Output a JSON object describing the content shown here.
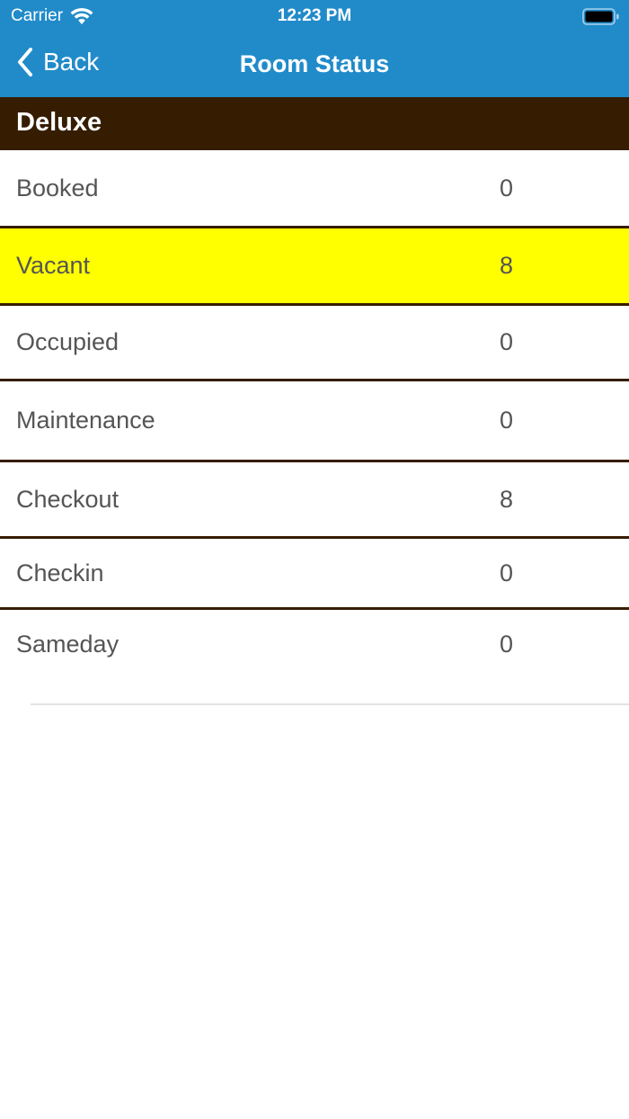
{
  "status_bar": {
    "carrier": "Carrier",
    "time": "12:23 PM"
  },
  "nav": {
    "back_label": "Back",
    "title": "Room Status"
  },
  "section": {
    "title": "Deluxe"
  },
  "rows": [
    {
      "label": "Booked",
      "value": "0"
    },
    {
      "label": "Vacant",
      "value": "8"
    },
    {
      "label": "Occupied",
      "value": "0"
    },
    {
      "label": "Maintenance",
      "value": "0"
    },
    {
      "label": "Checkout",
      "value": "8"
    },
    {
      "label": "Checkin",
      "value": "0"
    },
    {
      "label": "Sameday",
      "value": "0"
    }
  ],
  "colors": {
    "nav_background": "#218bca",
    "section_background": "#361d01",
    "highlight_row": "#ffff00",
    "text": "#555555"
  },
  "icons": {
    "wifi": "wifi-icon",
    "battery": "battery-icon",
    "back": "chevron-left-icon"
  }
}
